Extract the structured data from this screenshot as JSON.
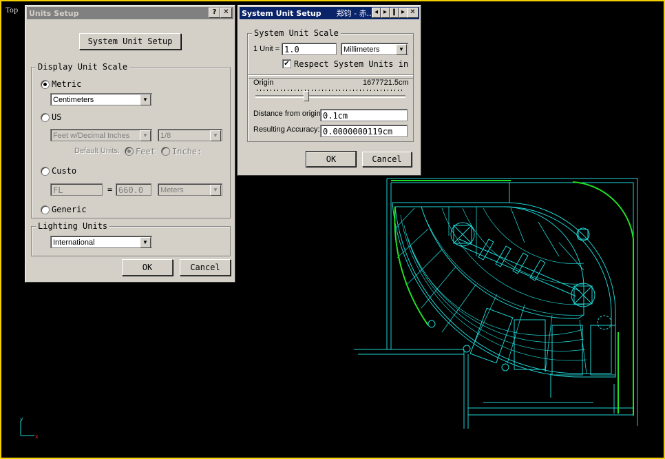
{
  "viewport": {
    "label": "Top"
  },
  "units_dialog": {
    "title": "Units Setup",
    "help_btn": "?",
    "close_btn": "✕",
    "system_unit_setup_btn": "System Unit Setup",
    "display_group": "Display Unit Scale",
    "metric_label": "Metric",
    "metric_value": "Centimeters",
    "us_label": "US",
    "us_value": "Feet w/Decimal Inches",
    "us_fraction": "1/8",
    "default_units_label": "Default Units:",
    "feet_label": "Feet",
    "inches_label": "Inche:",
    "custom_label": "Custo",
    "custom_name": "FL",
    "custom_eq": "=",
    "custom_value": "660.0",
    "custom_unit": "Meters",
    "generic_label": "Generic",
    "lighting_group": "Lighting Units",
    "lighting_value": "International",
    "ok": "OK",
    "cancel": "Cancel"
  },
  "system_dialog": {
    "title": "System Unit Setup",
    "title_extra": "郑钧 - 赤...",
    "close_btn": "✕",
    "scale_group": "System Unit Scale",
    "unit_label": "1 Unit =",
    "unit_value": "1.0",
    "unit_type": "Millimeters",
    "respect_label": "Respect System Units in",
    "respect_checked": true,
    "origin_label": "Origin",
    "origin_value": "1677721.5cm",
    "distance_label": "Distance from origin:",
    "distance_value": "0.1cm",
    "accuracy_label": "Resulting Accuracy:",
    "accuracy_value": "0.0000000119cm",
    "ok": "OK",
    "cancel": "Cancel"
  },
  "colors": {
    "viewport_border": "#f5d000",
    "title_active": "#0a246a",
    "title_inactive": "#808080",
    "plan_lines": "#1fd6d6",
    "plan_highlight": "#22e022"
  }
}
